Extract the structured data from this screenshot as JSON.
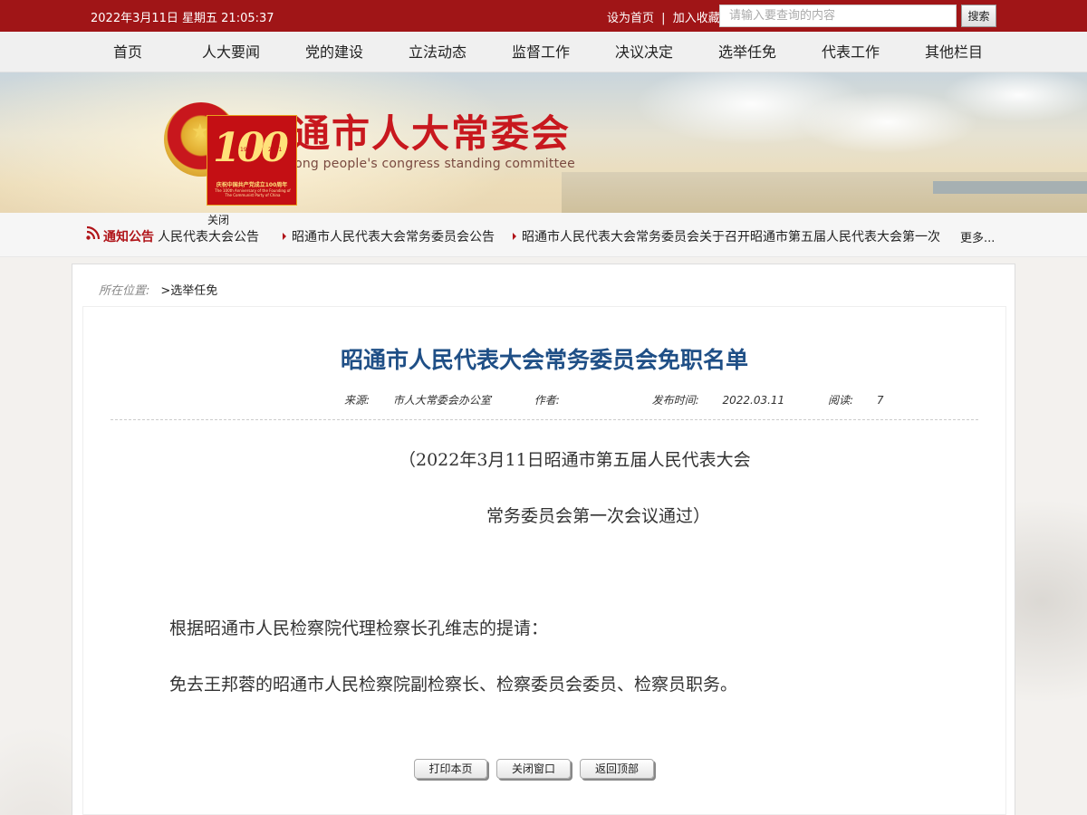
{
  "topbar": {
    "datetime": "2022年3月11日 星期五 21:05:37",
    "set_home": "设为首页",
    "separator": "|",
    "add_favorite": "加入收藏",
    "search_placeholder": "请输入要查询的内容",
    "search_button": "搜索"
  },
  "nav": {
    "items": [
      "首页",
      "人大要闻",
      "党的建设",
      "立法动态",
      "监督工作",
      "决议决定",
      "选举任免",
      "代表工作",
      "其他栏目"
    ]
  },
  "banner": {
    "title": "昭通市人大常委会",
    "subtitle": "Zhaotong people's congress standing committee"
  },
  "anniversary_badge": {
    "number": "100",
    "year_start": "1921",
    "year_end": "2021",
    "caption_cn": "庆祝中国共产党成立100周年",
    "caption_en": "The 100th Anniversary of the Founding of The Communist Party of China",
    "close_label": "关闭"
  },
  "notice": {
    "label": "通知公告",
    "items": [
      "人民代表大会公告",
      "昭通市人民代表大会常务委员会公告",
      "昭通市人民代表大会常务委员会关于召开昭通市第五届人民代表大会第一次"
    ],
    "more": "更多..."
  },
  "breadcrumb": {
    "label": "所在位置:",
    "path": ">选举任免"
  },
  "article": {
    "title": "昭通市人民代表大会常务委员会免职名单",
    "meta": {
      "source_label": "来源:",
      "source": "市人大常委会办公室",
      "author_label": "作者:",
      "author": "",
      "date_label": "发布时间:",
      "date": "2022.03.11",
      "reads_label": "阅读:",
      "reads": "7"
    },
    "paragraphs": [
      "（2022年3月11日昭通市第五届人民代表大会",
      "常务委员会第一次会议通过）",
      "根据昭通市人民检察院代理检察长孔维志的提请：",
      "免去王邦蓉的昭通市人民检察院副检察长、检察委员会委员、检察员职务。"
    ]
  },
  "actions": {
    "print": "打印本页",
    "close": "关闭窗口",
    "top": "返回顶部"
  },
  "colors": {
    "brand_red": "#a01517",
    "title_blue": "#1f4f86",
    "notice_red": "#b01419"
  }
}
